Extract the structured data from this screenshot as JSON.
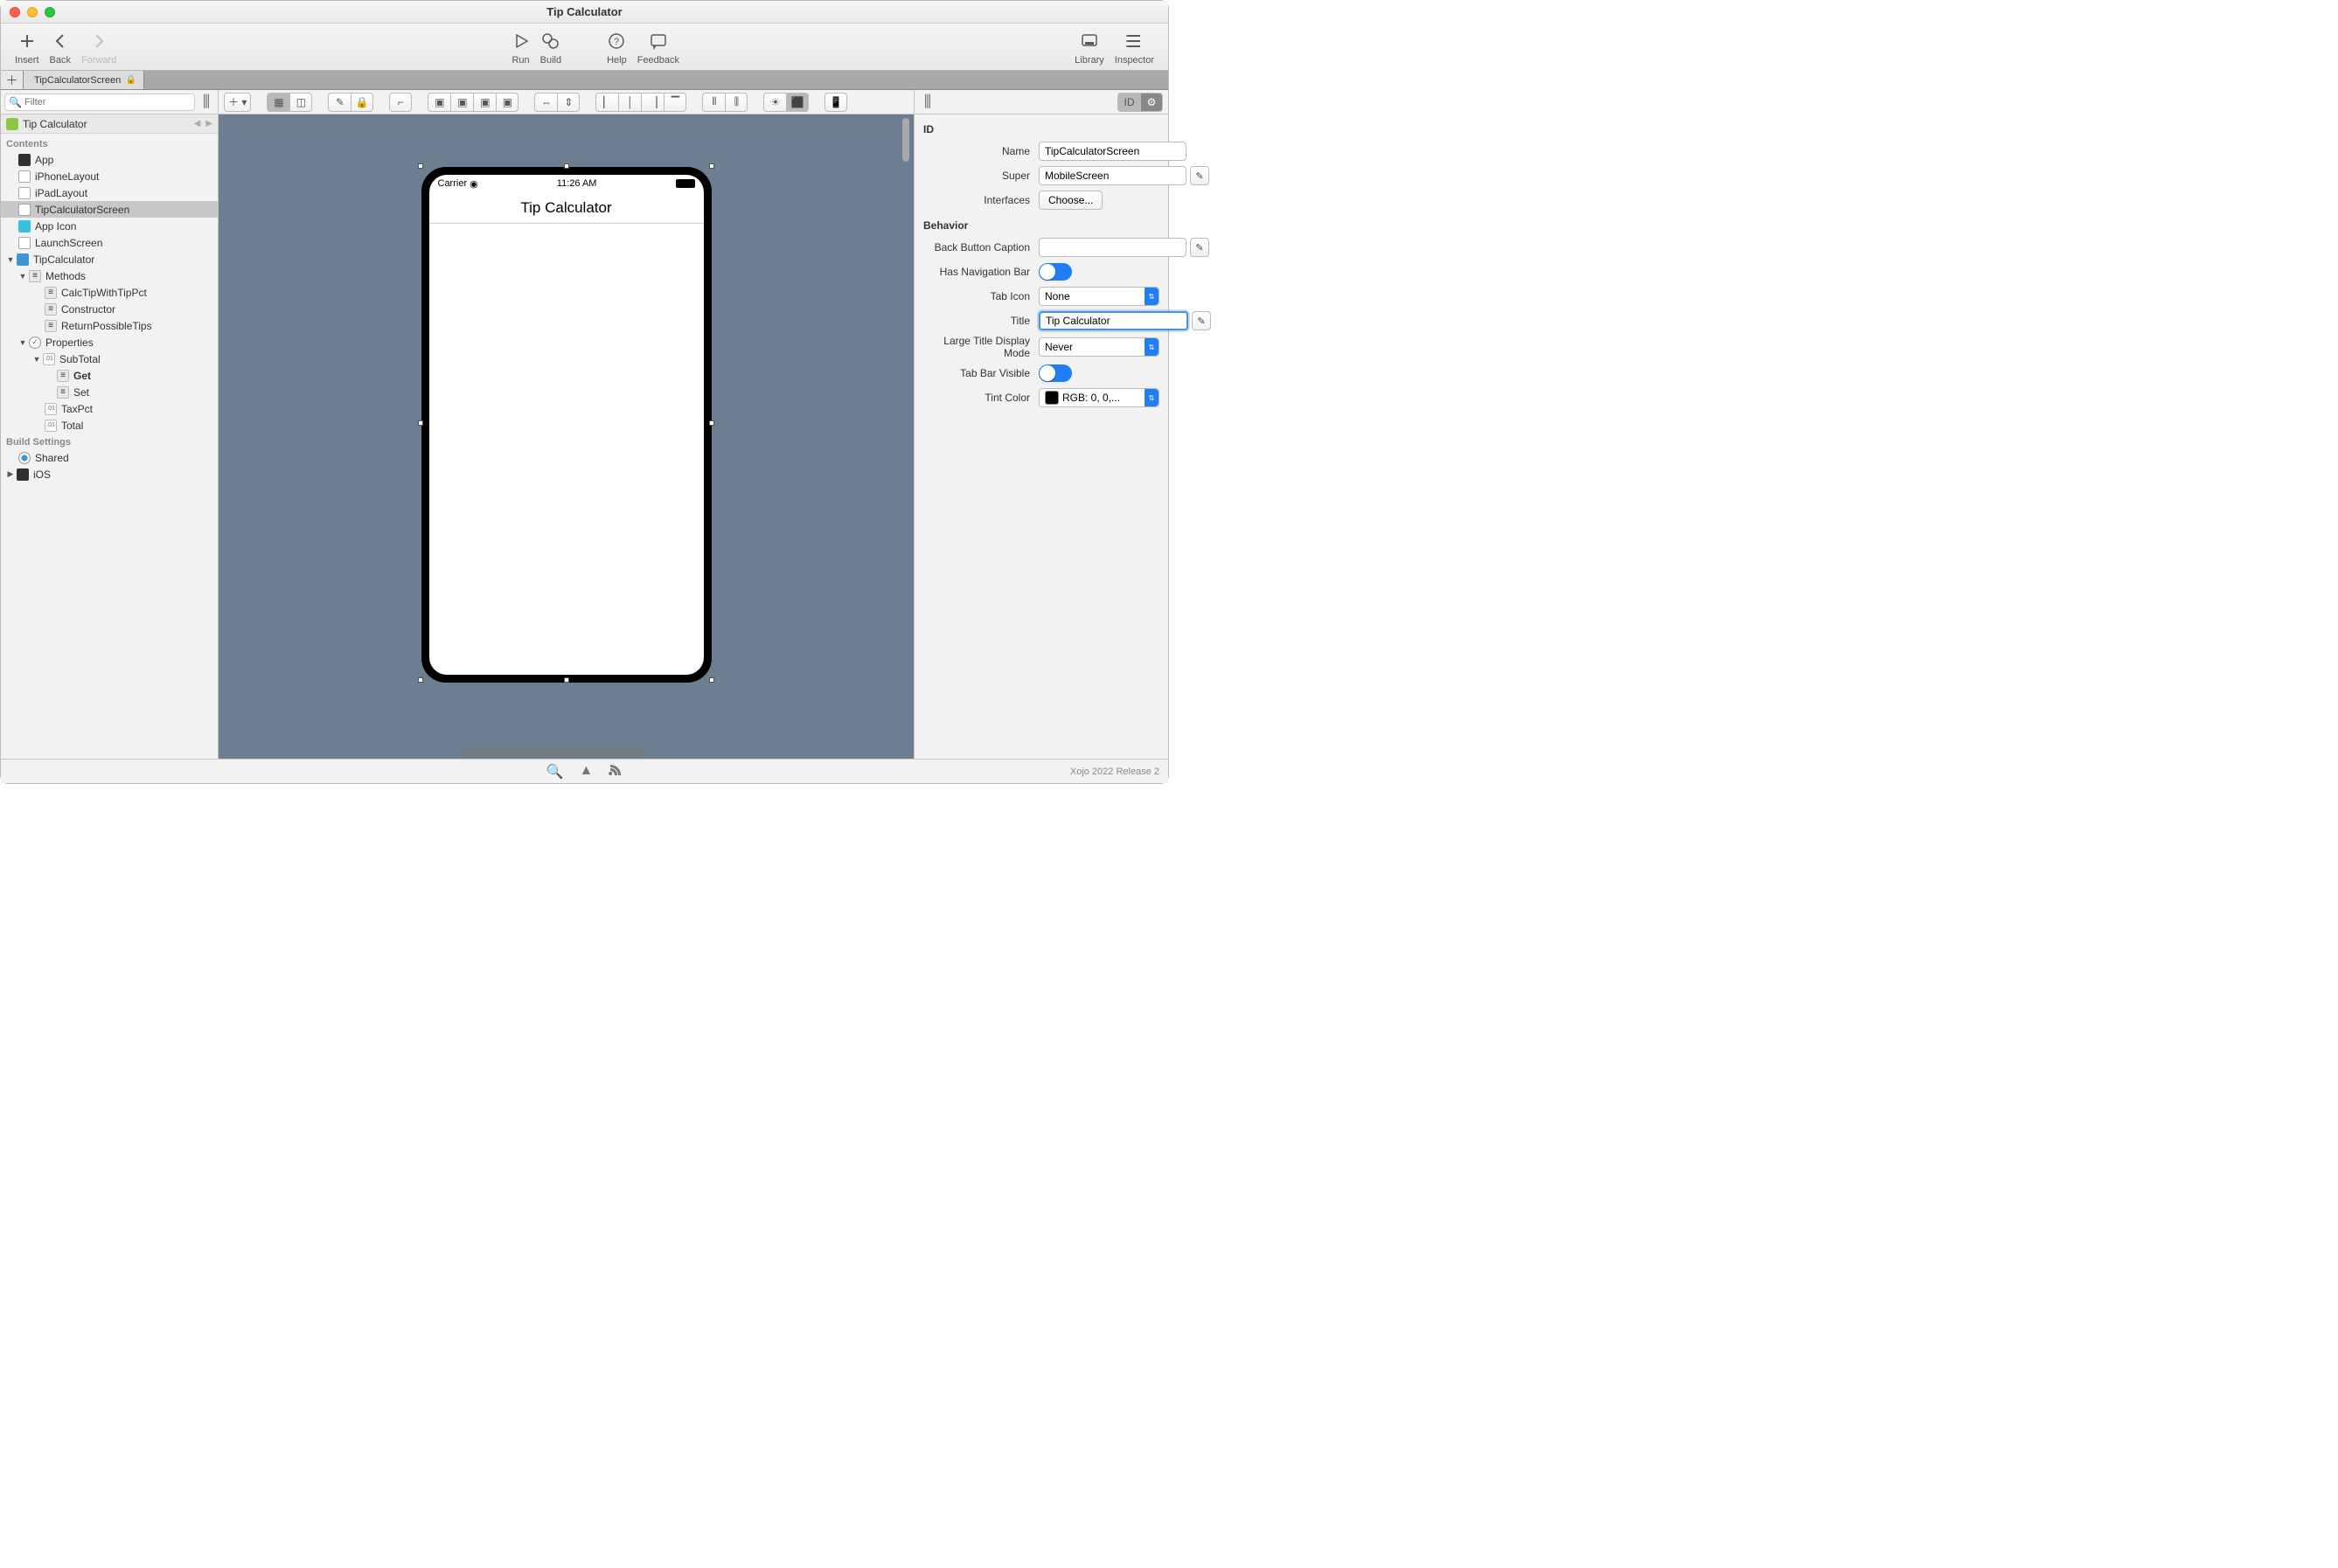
{
  "window": {
    "title": "Tip Calculator"
  },
  "toolbar": {
    "insert": "Insert",
    "back": "Back",
    "forward": "Forward",
    "run": "Run",
    "build": "Build",
    "help": "Help",
    "feedback": "Feedback",
    "library": "Library",
    "inspector": "Inspector"
  },
  "tab": {
    "name": "TipCalculatorScreen"
  },
  "left": {
    "filter_placeholder": "Filter",
    "header": "Tip Calculator",
    "sections": {
      "contents": "Contents",
      "build": "Build Settings"
    },
    "items": {
      "app": "App",
      "iphone": "iPhoneLayout",
      "ipad": "iPadLayout",
      "screen": "TipCalculatorScreen",
      "appicon": "App Icon",
      "launch": "LaunchScreen",
      "class": "TipCalculator",
      "methods_folder": "Methods",
      "m1": "CalcTipWithTipPct",
      "m2": "Constructor",
      "m3": "ReturnPossibleTips",
      "properties_folder": "Properties",
      "p1": "SubTotal",
      "p1_get": "Get",
      "p1_set": "Set",
      "p2": "TaxPct",
      "p3": "Total",
      "shared": "Shared",
      "ios": "iOS"
    }
  },
  "device": {
    "carrier": "Carrier",
    "clock": "11:26 AM",
    "navtitle": "Tip Calculator"
  },
  "inspector": {
    "section_id": "ID",
    "name_label": "Name",
    "name_value": "TipCalculatorScreen",
    "super_label": "Super",
    "super_value": "MobileScreen",
    "interfaces_label": "Interfaces",
    "choose_label": "Choose...",
    "section_behavior": "Behavior",
    "back_button_label": "Back Button Caption",
    "has_nav_label": "Has Navigation Bar",
    "tab_icon_label": "Tab Icon",
    "tab_icon_value": "None",
    "title_label": "Title",
    "title_value": "Tip Calculator",
    "large_title_label": "Large Title Display Mode",
    "large_title_value": "Never",
    "tabbar_visible_label": "Tab Bar Visible",
    "tint_label": "Tint Color",
    "tint_value": "RGB: 0, 0,..."
  },
  "footer": {
    "version": "Xojo 2022 Release 2"
  }
}
